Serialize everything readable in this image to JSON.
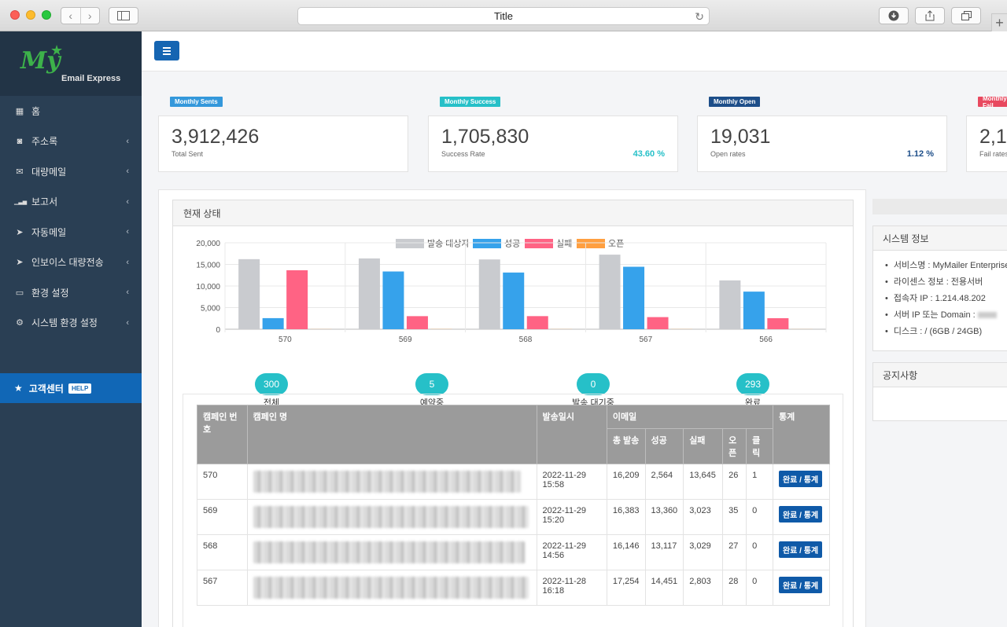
{
  "browser": {
    "title": "Title"
  },
  "logo": {
    "my": "My",
    "brand": "Email Express"
  },
  "sidebar": {
    "items": [
      {
        "label": "홈",
        "icon": "dashboard-icon",
        "glyph": "▦",
        "chev": ""
      },
      {
        "label": "주소록",
        "icon": "address-book-icon",
        "glyph": "◙",
        "chev": "‹"
      },
      {
        "label": "대량메일",
        "icon": "envelope-icon",
        "glyph": "✉",
        "chev": "‹"
      },
      {
        "label": "보고서",
        "icon": "signal-icon",
        "glyph": "▁▃▅",
        "chev": "‹"
      },
      {
        "label": "자동메일",
        "icon": "paper-plane-icon",
        "glyph": "➤",
        "chev": "‹"
      },
      {
        "label": "인보이스 대량전송",
        "icon": "paper-plane-icon",
        "glyph": "➤",
        "chev": "‹"
      },
      {
        "label": "환경 설정",
        "icon": "desktop-icon",
        "glyph": "▭",
        "chev": "‹"
      },
      {
        "label": "시스템 환경 설정",
        "icon": "gear-icon",
        "glyph": "⚙",
        "chev": "‹"
      }
    ],
    "help": {
      "label": "고객센터",
      "badge": "HELP"
    }
  },
  "stats": [
    {
      "tag": "Monthly Sents",
      "tagColor": "#3498db",
      "value": "3,912,426",
      "sub": "Total Sent",
      "pct": "",
      "pctColor": ""
    },
    {
      "tag": "Monthly Success",
      "tagColor": "#26c0c8",
      "value": "1,705,830",
      "sub": "Success Rate",
      "pct": "43.60 %",
      "pctColor": "#26c0c8"
    },
    {
      "tag": "Monthly Open",
      "tagColor": "#1d4e89",
      "value": "19,031",
      "sub": "Open rates",
      "pct": "1.12 %",
      "pctColor": "#1d4e89"
    },
    {
      "tag": "Monthly Fail",
      "tagColor": "#e8495f",
      "value": "2,1",
      "sub": "Fail rates",
      "pct": "",
      "pctColor": ""
    }
  ],
  "status_panel": {
    "title": "현재 상태",
    "summary": [
      {
        "value": "300",
        "label": "전체"
      },
      {
        "value": "5",
        "label": "예약중"
      },
      {
        "value": "0",
        "label": "발송 대기중"
      },
      {
        "value": "293",
        "label": "완료"
      }
    ]
  },
  "chart_data": {
    "type": "bar",
    "categories": [
      "570",
      "569",
      "568",
      "567",
      "566"
    ],
    "series": [
      {
        "name": "발송 대상자",
        "color": "#c9cbcf",
        "values": [
          16209,
          16383,
          16146,
          17254,
          11300
        ]
      },
      {
        "name": "성공",
        "color": "#36a2eb",
        "values": [
          2564,
          13360,
          13117,
          14451,
          8700
        ]
      },
      {
        "name": "실패",
        "color": "#ff6384",
        "values": [
          13645,
          3023,
          3029,
          2803,
          2550
        ]
      },
      {
        "name": "오픈",
        "color": "#ff9f40",
        "values": [
          26,
          35,
          27,
          28,
          20
        ]
      }
    ],
    "ylim": [
      0,
      20000
    ],
    "yticks": [
      "0",
      "5,000",
      "10,000",
      "15,000",
      "20,000"
    ],
    "legend": "top",
    "grid": true
  },
  "table": {
    "headers": {
      "no": "캠페인 번호",
      "name": "캠페인 명",
      "date": "발송일시",
      "email": "이메일",
      "stats": "통계",
      "total": "총 발송",
      "success": "성공",
      "fail": "실패",
      "open": "오픈",
      "click": "클릭"
    },
    "rows": [
      {
        "no": "570",
        "date": "2022-11-29 15:58",
        "total": "16,209",
        "success": "2,564",
        "fail": "13,645",
        "open": "26",
        "click": "1",
        "status": "완료 / 통계"
      },
      {
        "no": "569",
        "date": "2022-11-29 15:20",
        "total": "16,383",
        "success": "13,360",
        "fail": "3,023",
        "open": "35",
        "click": "0",
        "status": "완료 / 통계"
      },
      {
        "no": "568",
        "date": "2022-11-29 14:56",
        "total": "16,146",
        "success": "13,117",
        "fail": "3,029",
        "open": "27",
        "click": "0",
        "status": "완료 / 통계"
      },
      {
        "no": "567",
        "date": "2022-11-28 16:18",
        "total": "17,254",
        "success": "14,451",
        "fail": "2,803",
        "open": "28",
        "click": "0",
        "status": "완료 / 통계"
      }
    ]
  },
  "system_info": {
    "title": "시스템 정보",
    "items": [
      "서비스명 : MyMailer Enterprise",
      "라이센스 정보 : 전용서버",
      "접속자 IP : 1.214.48.202",
      "서버 IP 또는 Domain : ",
      "디스크 : / (6GB / 24GB)"
    ]
  },
  "notice": {
    "title": "공지사항"
  }
}
